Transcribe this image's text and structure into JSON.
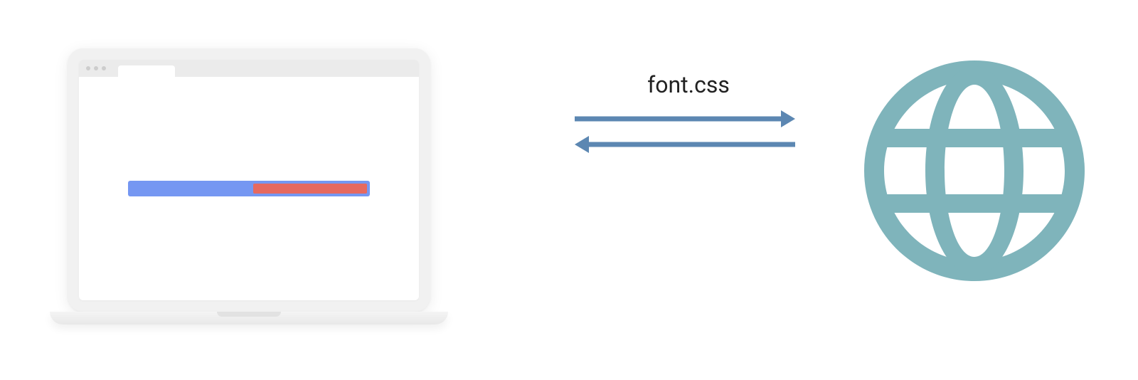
{
  "diagram": {
    "request_label": "font.css",
    "colors": {
      "arrow": "#5c87b2",
      "globe": "#7fb4bb",
      "progress_bg": "#7597f2",
      "progress_fill": "#e66960",
      "laptop_frame": "#f1f1f1"
    },
    "elements": {
      "laptop": "laptop-with-browser",
      "arrow_right": "request-arrow",
      "arrow_left": "response-arrow",
      "globe": "web-globe"
    }
  }
}
